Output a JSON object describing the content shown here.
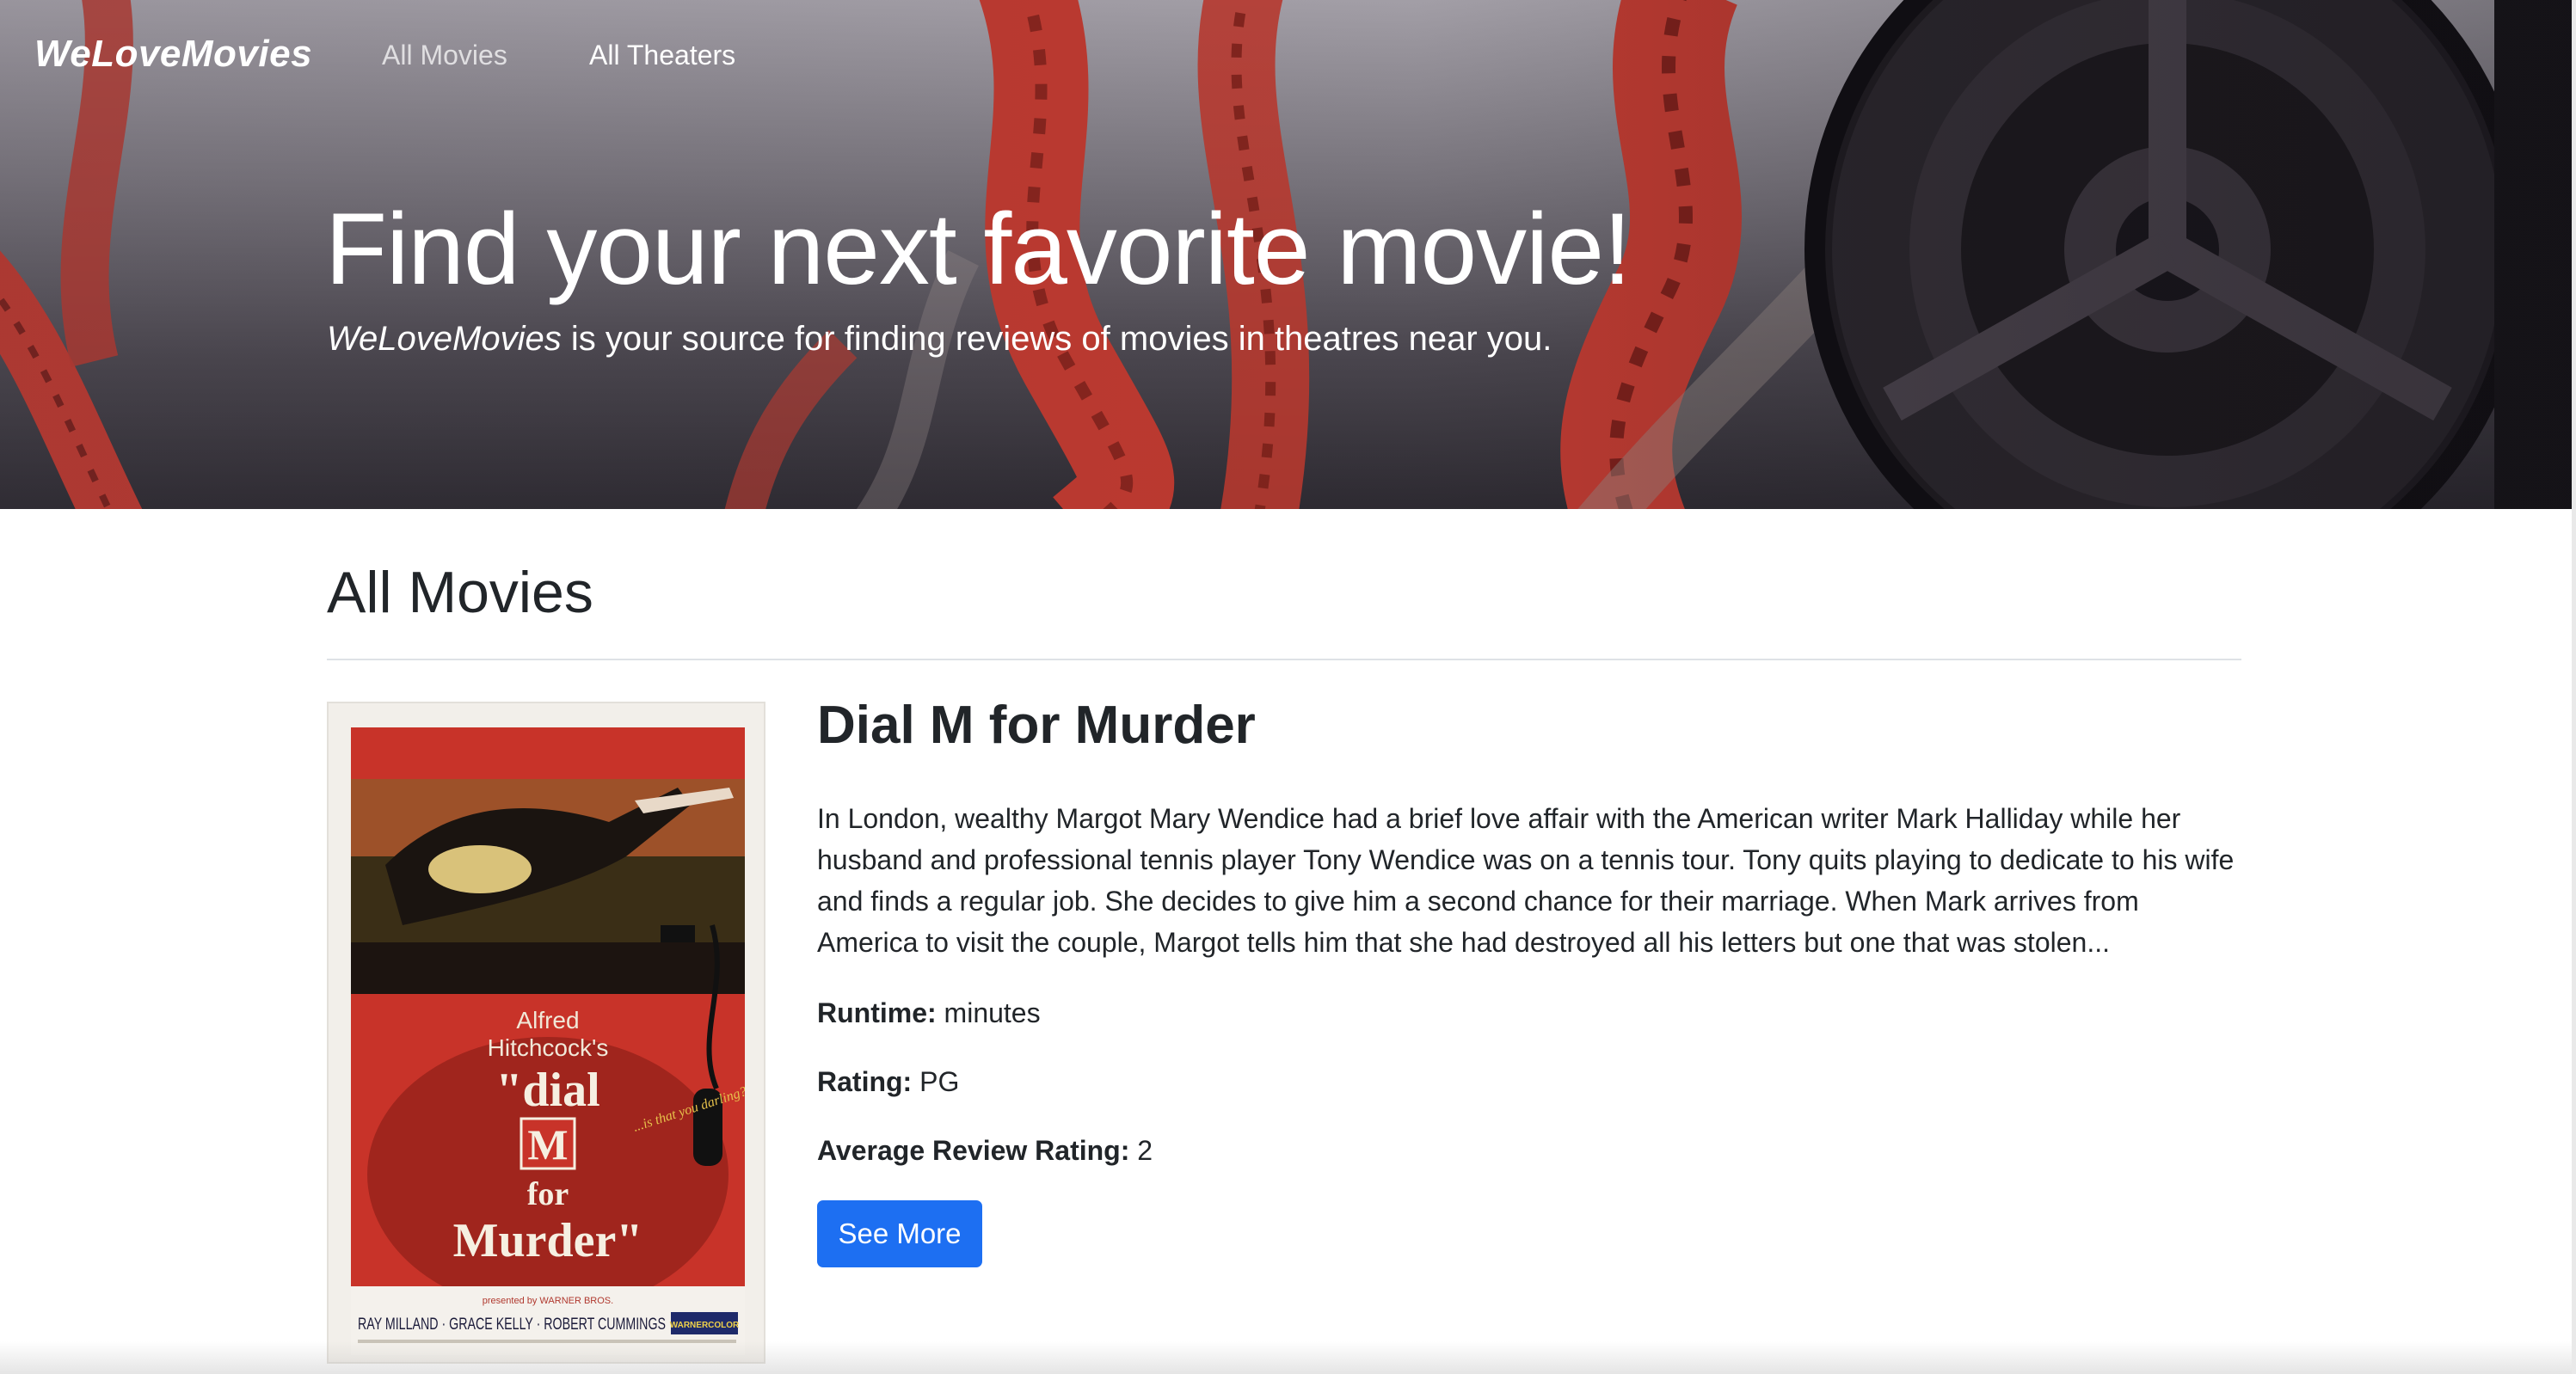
{
  "nav": {
    "brand": "WeLoveMovies",
    "links": [
      "All Movies",
      "All Theaters"
    ]
  },
  "hero": {
    "title": "Find your next favorite movie!",
    "subtitle_brand": "WeLoveMovies",
    "subtitle_rest": " is your source for finding reviews of movies in theatres near you."
  },
  "main": {
    "section_title": "All Movies",
    "movies": [
      {
        "title": "Dial M for Murder",
        "description": "In London, wealthy Margot Mary Wendice had a brief love affair with the American writer Mark Halliday while her husband and professional tennis player Tony Wendice was on a tennis tour. Tony quits playing to dedicate to his wife and finds a regular job. She decides to give him a second chance for their marriage. When Mark arrives from America to visit the couple, Margot tells him that she had destroyed all his letters but one that was stolen...",
        "runtime_label": "Runtime:",
        "runtime_value": " minutes",
        "rating_label": "Rating:",
        "rating_value": " PG",
        "avg_label": "Average Review Rating:",
        "avg_value": " 2",
        "button": "See More",
        "poster": {
          "line1": "Alfred",
          "line2": "Hitchcock's",
          "word1": "\"dial",
          "word2": "M",
          "word3": "for",
          "word4": "Murder\"",
          "tagline": "...is that you darling?",
          "presented": "presented by WARNER BROS.",
          "cast": "RAY MILLAND · GRACE KELLY · ROBERT CUMMINGS",
          "badge": "WARNERCOLOR"
        }
      }
    ]
  },
  "colors": {
    "primary_button": "#1d6ff2",
    "film_red": "#c8342c"
  }
}
